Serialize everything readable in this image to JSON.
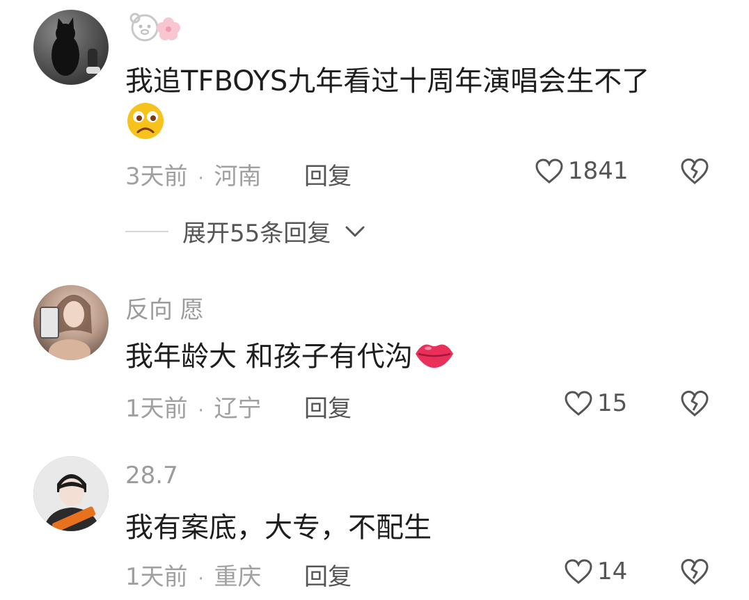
{
  "comments": [
    {
      "username": "",
      "text": "我追TFBOYS九年看过十周年演唱会生不了",
      "time": "3天前",
      "location": "河南",
      "reply_label": "回复",
      "likes": "1841"
    },
    {
      "username": "反向 愿",
      "text": "我年龄大 和孩子有代沟",
      "time": "1天前",
      "location": "辽宁",
      "reply_label": "回复",
      "likes": "15"
    },
    {
      "username": "28.7",
      "text": "我有案底，大专，不配生",
      "time": "1天前",
      "location": "重庆",
      "reply_label": "回复",
      "likes": "14"
    }
  ],
  "expand_replies": {
    "label": "展开55条回复"
  },
  "meta_separator": "·",
  "icons": {
    "like": "heart-outline-icon",
    "dislike": "broken-heart-icon",
    "expand": "chevron-down-icon",
    "emoji_sad": "sad-face-emoji",
    "emoji_kiss": "lips-emoji",
    "username_emoji": "bear-face-emoji"
  },
  "colors": {
    "text_primary": "#1e1e1e",
    "text_secondary": "#9b9b9b",
    "action": "#555555",
    "kiss": "#e8305a",
    "emoji_yellow": "#f7c21b"
  }
}
